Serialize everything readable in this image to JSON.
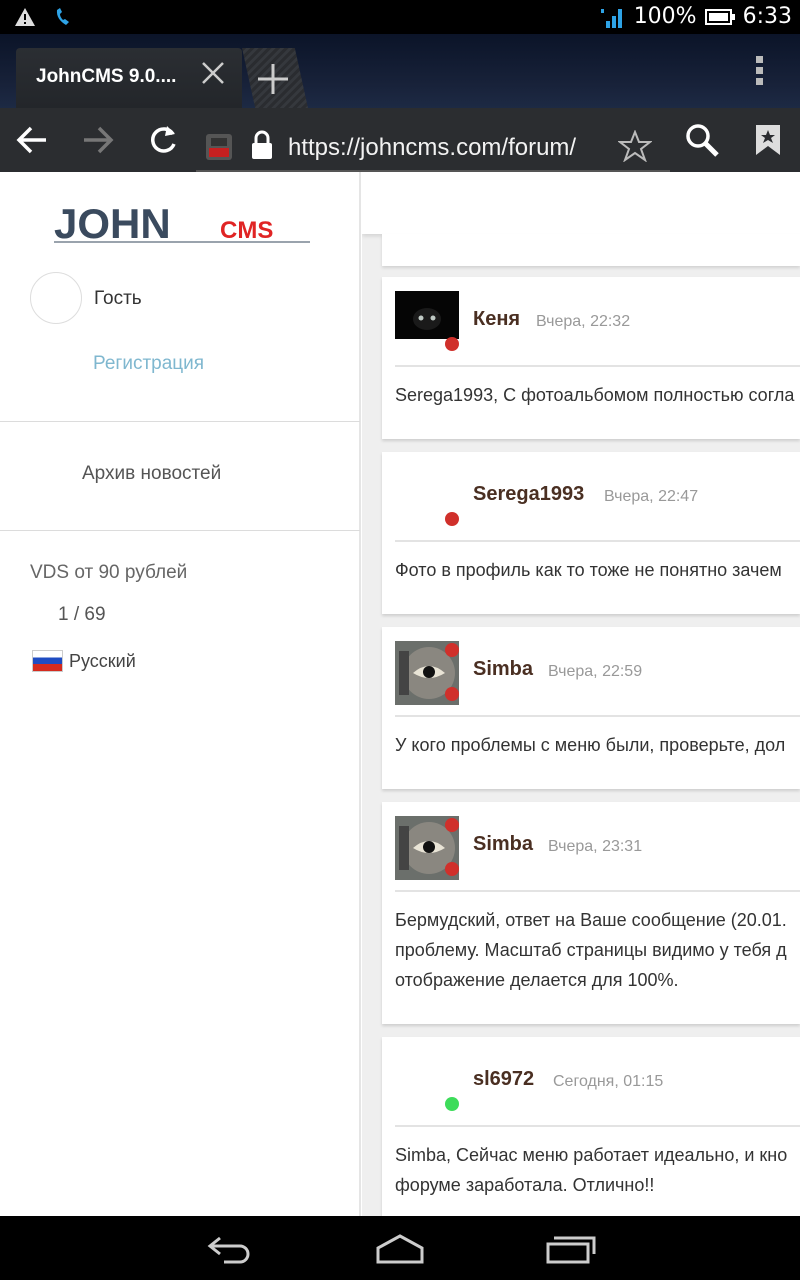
{
  "status": {
    "battery": "100%",
    "time": "6:33"
  },
  "browser": {
    "tab_title": "JohnCMS 9.0....",
    "url": "https://johncms.com/forum/"
  },
  "sidebar": {
    "logo_text_main": "JOHN",
    "logo_text_accent": "CMS",
    "guest_label": "Гость",
    "register_link": "Регистрация",
    "archive_link": "Архив новостей",
    "vds_link": "VDS от 90 рублей",
    "counter": "1 / 69",
    "language": "Русский"
  },
  "posts": [
    {
      "author": "Кеня",
      "date": "Вчера, 22:32",
      "status": "offline",
      "avatar": "black-cat",
      "lines": [
        "Serega1993, С фотоальбомом полностью согла"
      ]
    },
    {
      "author": "Serega1993",
      "date": "Вчера, 22:47",
      "status": "offline",
      "avatar": "none",
      "lines": [
        "Фото в профиль как то тоже не понятно зачем"
      ]
    },
    {
      "author": "Simba",
      "date": "Вчера, 22:59",
      "status": "offline",
      "avatar": "eye-robot",
      "lines": [
        "У кого проблемы с меню были, проверьте, дол"
      ]
    },
    {
      "author": "Simba",
      "date": "Вчера, 23:31",
      "status": "offline",
      "avatar": "eye-robot",
      "lines": [
        "Бермудский, ответ на Ваше сообщение (20.01.",
        "проблему. Масштаб страницы видимо у тебя д",
        "отображение делается для 100%."
      ]
    },
    {
      "author": "sl6972",
      "date": "Сегодня, 01:15",
      "status": "online",
      "avatar": "none",
      "lines": [
        "Simba, Сейчас меню работает идеально, и кно",
        "форуме заработала. Отлично!!"
      ]
    }
  ],
  "colors": {
    "offline": "#d0302b",
    "online": "#3ddc5a",
    "author": "#4a2f22",
    "link": "#7fb7cf"
  }
}
